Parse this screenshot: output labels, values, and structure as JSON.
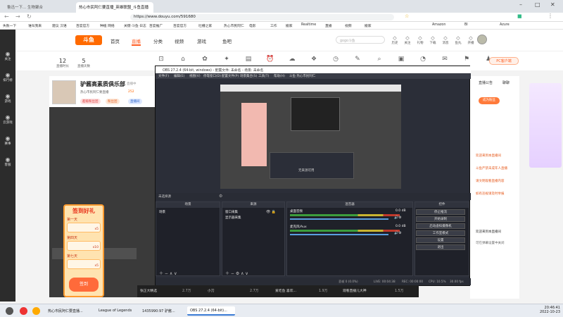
{
  "browser": {
    "tabs": [
      "鲁迅一下... 生物聚合",
      "热心市民阿仁要直播_英雄联盟_斗鱼直播"
    ],
    "url": "https://www.douyu.com/591680",
    "bookmarks": [
      "失败一下",
      "谁叫我来",
      "建议 汉语",
      "百度官方",
      "种植 网络",
      "关键·斗鱼·日志",
      "百度推广",
      "百度官方",
      "吐槽之家",
      "热心市民阿仁",
      "电影",
      "工作",
      "搬家",
      "Realtime",
      "直播",
      "视频",
      "搬家",
      "Amazon",
      "BI",
      "Azure"
    ]
  },
  "sidebar": [
    {
      "label": "关注",
      "icon": "heart-icon"
    },
    {
      "label": "排行榜",
      "icon": "rank-icon"
    },
    {
      "label": "游戏",
      "icon": "gamepad-icon"
    },
    {
      "label": "云游戏",
      "icon": "cloud-icon"
    },
    {
      "label": "赛事",
      "icon": "trophy-icon"
    },
    {
      "label": "客服",
      "icon": "headset-icon"
    }
  ],
  "header": {
    "logo": "斗鱼",
    "nav": [
      "首页",
      "直播",
      "分类",
      "视频",
      "游戏",
      "鱼吧"
    ],
    "active_nav": "直播",
    "search_placeholder": "gogo斗鱼",
    "icons": [
      {
        "name": "history-icon",
        "label": "历史"
      },
      {
        "name": "follow-icon",
        "label": "关注"
      },
      {
        "name": "gift-icon",
        "label": "礼物"
      },
      {
        "name": "download-icon",
        "label": "下载"
      },
      {
        "name": "message-icon",
        "label": "消息"
      },
      {
        "name": "fish-icon",
        "label": "鱼丸"
      },
      {
        "name": "live-icon",
        "label": "开播"
      }
    ]
  },
  "catbar": {
    "stats": [
      {
        "value": "12",
        "label": "直播时长"
      },
      {
        "value": "5",
        "label": "直播天数"
      }
    ],
    "pc_button": "PC客户端"
  },
  "streamer": {
    "name": "驴酱高素质俱乐部",
    "status": "直播中",
    "room": "热心市民阿仁要直播",
    "followers": "252",
    "tags": [
      "超级粉丝团",
      "粉丝团",
      "直播间"
    ]
  },
  "checkin": {
    "title": "签到好礼",
    "days": [
      "第一天",
      "第四天",
      "第七天"
    ],
    "rewards": [
      "x5",
      "x10",
      "x5"
    ],
    "footer": "签到"
  },
  "right_panel": {
    "tabs": [
      "直播公告",
      "聊聊"
    ],
    "lines": [
      "欢迎来到本直播间",
      "斗鱼严禁未成年人直播",
      "请文明观看直播内容",
      "如有违规请及时举报"
    ],
    "welcome": "欢迎来到本直播间",
    "notice": "可在弹幕设置中关闭"
  },
  "obs": {
    "title": "OBS 27.2.4 (64-bit, windows) - 配置文件: 未命名 - 场景: 未命名",
    "menu": [
      "文件(F)",
      "编辑(E)",
      "视图(V)",
      "停靠窗口(D)",
      "配置文件(P)",
      "场景集合(S)",
      "工具(T)",
      "帮助(H)",
      "斗鱼 热心市民阿仁"
    ],
    "preview_caption": "无来源可用",
    "dock_bar": "未选择源",
    "panels": {
      "scenes": {
        "title": "场景",
        "items": [
          "场景"
        ]
      },
      "sources": {
        "title": "来源",
        "items": [
          "窗口采集",
          "显示器采集"
        ]
      },
      "mixer": {
        "title": "混音器",
        "tracks": [
          {
            "name": "桌面音频",
            "level": "0.0 dB"
          },
          {
            "name": "麦克风/Aux",
            "level": "0.0 dB"
          }
        ]
      },
      "controls": {
        "title": "控件",
        "buttons": [
          "停止推流",
          "开始录制",
          "启动虚拟摄像机",
          "工作室模式",
          "设置",
          "退出"
        ]
      }
    },
    "status": {
      "dropped": "丢帧 0 (0.0%)",
      "live": "LIVE: 00:04:38",
      "rec": "REC: 00:00:00",
      "cpu": "CPU: 10.5%",
      "fps": "30.00 fps",
      "kbps": "kb/s: 2500"
    }
  },
  "bottom_strip": {
    "items": [
      "张正大精选",
      "小刀",
      "爱吃鱼 喜欢...",
      "观看直播儿大神"
    ],
    "counts": [
      "2.7万",
      "2.7万",
      "1.9万",
      "1.5万"
    ]
  },
  "taskbar": {
    "apps": [
      "热心市民阿仁要直播...",
      "League of Legends",
      "1435990:97 驴酱...",
      "OBS 27.2.4 (64-bit)..."
    ],
    "time": "20:46:41",
    "date": "2022-10-23"
  }
}
